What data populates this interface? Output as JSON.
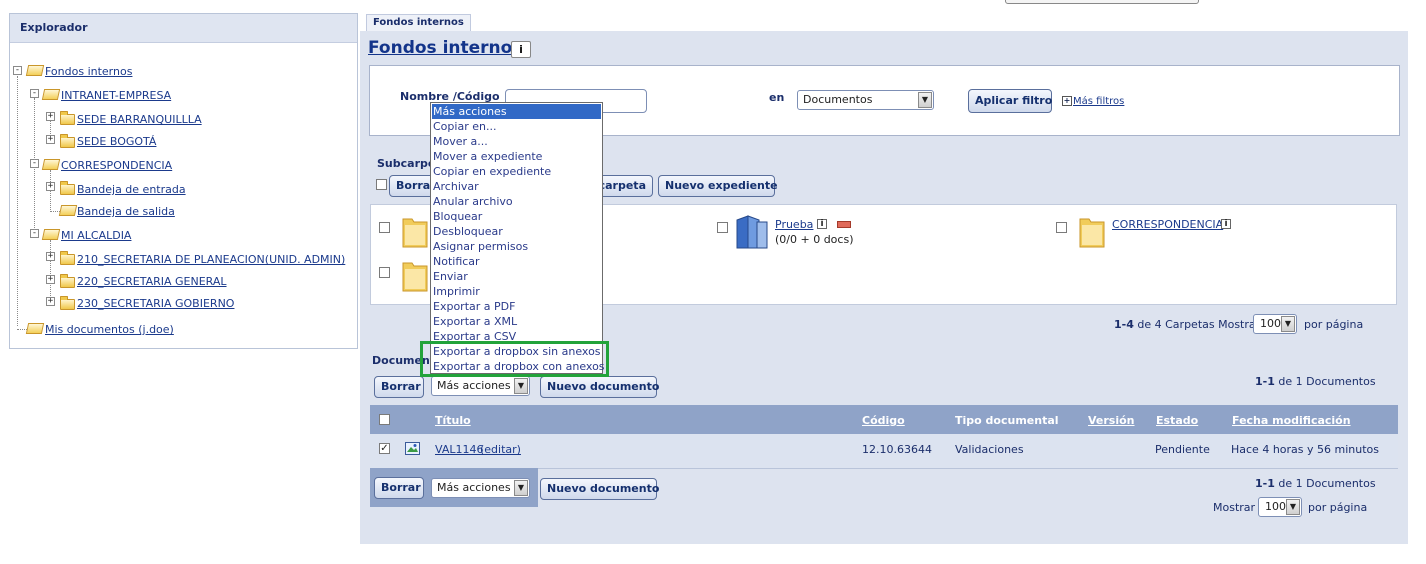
{
  "explorer": {
    "title": "Explorador",
    "tree": [
      {
        "label": "Fondos internos"
      },
      {
        "label": "INTRANET-EMPRESA"
      },
      {
        "label": "SEDE BARRANQUILLLA"
      },
      {
        "label": "SEDE BOGOTÁ"
      },
      {
        "label": "CORRESPONDENCIA"
      },
      {
        "label": "Bandeja de entrada"
      },
      {
        "label": "Bandeja de salida"
      },
      {
        "label": "MI ALCALDIA"
      },
      {
        "label": "210_SECRETARIA DE PLANEACION(UNID. ADMIN)"
      },
      {
        "label": "220_SECRETARIA GENERAL"
      },
      {
        "label": "230_SECRETARIA GOBIERNO"
      },
      {
        "label": "Mis documentos (j.doe)"
      }
    ]
  },
  "tab": {
    "label": "Fondos internos"
  },
  "page": {
    "title": "Fondos internos",
    "info_icon": "i"
  },
  "filter": {
    "name_label": "Nombre /Código",
    "name_value": "",
    "en_label": "en",
    "en_value": "Documentos",
    "apply_label": "Aplicar filtro",
    "more_toggle": "+",
    "more_label": "Más filtros"
  },
  "subfolders": {
    "label": "Subcarpe",
    "delete_label": "Borrar",
    "new_folder_label": "carpeta",
    "new_expediente_label": "Nuevo expediente",
    "items": [
      {
        "name": "Prueba",
        "info_icon": "i",
        "detail": "(0/0 + 0 docs)"
      },
      {
        "name": "CORRESPONDENCIA",
        "info_icon": "i"
      }
    ],
    "pagination": {
      "range": "1-4",
      "of": "de",
      "total": "4",
      "unit": "Carpetas",
      "show_label": "Mostrar",
      "per_page": "100",
      "per_page_label": "por página"
    }
  },
  "documents": {
    "label": "Document",
    "delete_label": "Borrar",
    "actions_label": "Más acciones",
    "new_doc_label": "Nuevo documento",
    "pagination": {
      "range": "1-1",
      "of": "de",
      "total": "1",
      "unit": "Documentos",
      "show_label": "Mostrar",
      "per_page": "100",
      "per_page_label": "por página"
    },
    "columns": [
      "Título",
      "Código",
      "Tipo documental",
      "Versión",
      "Estado",
      "Fecha modificación"
    ],
    "rows": [
      {
        "title": "VAL1146",
        "edit": "(editar)",
        "code": "12.10.63644",
        "type": "Validaciones",
        "version": "",
        "status": "Pendiente",
        "modified": "Hace 4 horas y 56 minutos",
        "checked": true
      }
    ]
  },
  "menu": {
    "items": [
      "Más acciones",
      "Copiar en...",
      "Mover a...",
      "Mover a expediente",
      "Copiar en expediente",
      "Archivar",
      "Anular archivo",
      "Bloquear",
      "Desbloquear",
      "Asignar permisos",
      "Notificar",
      "Enviar",
      "Imprimir",
      "Exportar a PDF",
      "Exportar a XML",
      "Exportar a CSV",
      "Exportar a dropbox sin anexos",
      "Exportar a dropbox con anexos"
    ],
    "highlight_color": "#22a33a",
    "active_color": "#3169c6"
  },
  "colors": {
    "panel_bg": "#dde3ef",
    "header_bg": "#8fa3c8",
    "title": "#13348a"
  }
}
